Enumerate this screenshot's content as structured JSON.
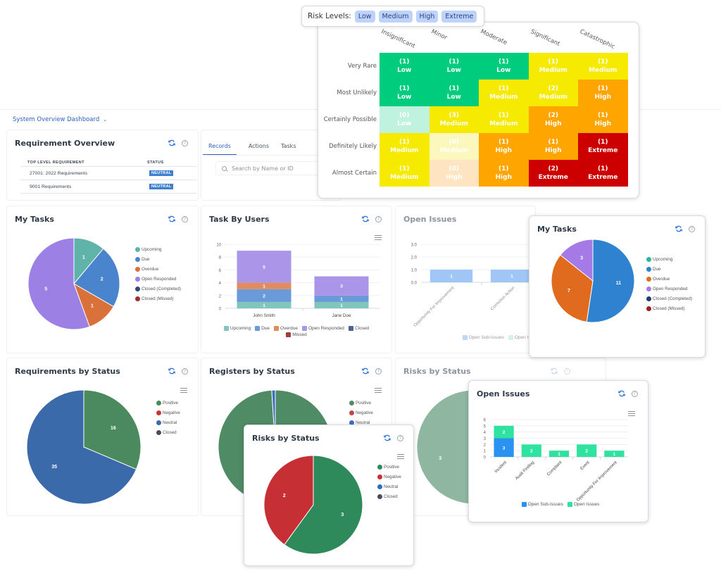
{
  "header": {
    "dashboard_title": "System Overview Dashboard",
    "dashboard_chevron_icon": "chevron-down-icon"
  },
  "risk_levels": {
    "label": "Risk Levels:",
    "chips": [
      "Low",
      "Medium",
      "High",
      "Extreme"
    ]
  },
  "risk_matrix": {
    "columns": [
      "Insignificant",
      "Minor",
      "Moderate",
      "Significant",
      "Catastrophic"
    ],
    "rows": [
      "Very Rare",
      "Most Unlikely",
      "Certainly Possible",
      "Definitely Likely",
      "Almost Certain"
    ],
    "colors": {
      "Low": "#00cc7e",
      "Low-empty": "#c0f2e0",
      "Medium": "#f5ea00",
      "Medium-empty": "#fcf8bd",
      "High": "#ffa500",
      "High-empty": "#ffe4c2",
      "Extreme": "#cc0000"
    },
    "cells": [
      [
        {
          "count": "(1)",
          "level": "Low"
        },
        {
          "count": "(1)",
          "level": "Low"
        },
        {
          "count": "(1)",
          "level": "Low"
        },
        {
          "count": "(1)",
          "level": "Medium"
        },
        {
          "count": "(1)",
          "level": "Medium"
        }
      ],
      [
        {
          "count": "(1)",
          "level": "Low"
        },
        {
          "count": "(1)",
          "level": "Low"
        },
        {
          "count": "(1)",
          "level": "Medium"
        },
        {
          "count": "(2)",
          "level": "Medium"
        },
        {
          "count": "(1)",
          "level": "High"
        }
      ],
      [
        {
          "count": "(0)",
          "level": "Low"
        },
        {
          "count": "(3)",
          "level": "Medium"
        },
        {
          "count": "(1)",
          "level": "Medium"
        },
        {
          "count": "(2)",
          "level": "High"
        },
        {
          "count": "(1)",
          "level": "High"
        }
      ],
      [
        {
          "count": "(1)",
          "level": "Medium"
        },
        {
          "count": "(0)",
          "level": "Medium"
        },
        {
          "count": "(1)",
          "level": "High"
        },
        {
          "count": "(1)",
          "level": "High"
        },
        {
          "count": "(1)",
          "level": "Extreme"
        }
      ],
      [
        {
          "count": "(1)",
          "level": "Medium"
        },
        {
          "count": "(0)",
          "level": "High"
        },
        {
          "count": "(1)",
          "level": "High"
        },
        {
          "count": "(2)",
          "level": "Extreme"
        },
        {
          "count": "(1)",
          "level": "Extreme"
        }
      ]
    ]
  },
  "requirement_overview": {
    "title": "Requirement Overview",
    "columns": [
      "TOP LEVEL REQUIREMENT",
      "STATUS"
    ],
    "rows": [
      {
        "name": "27001: 2022 Requirements",
        "status": "NEUTRAL"
      },
      {
        "name": "9001 Requirements",
        "status": "NEUTRAL"
      }
    ],
    "status_color": "#3f7fcf"
  },
  "records_panel": {
    "tabs": [
      "Records",
      "Actions",
      "Tasks"
    ],
    "active_tab": "Records",
    "search_placeholder": "Search by Name or ID"
  },
  "icons": {
    "refresh": "refresh-icon",
    "help": "help-icon",
    "help_glyph": "?",
    "menu": "hamburger-menu-icon",
    "search": "search-icon"
  },
  "chart_data": [
    {
      "id": "my_tasks_1",
      "type": "pie",
      "title": "My Tasks",
      "labels": [
        "Upcoming",
        "Due",
        "Overdue",
        "Open Responded",
        "Closed (Completed)",
        "Closed (Missed)"
      ],
      "values": [
        1,
        2,
        1,
        5,
        0,
        0
      ],
      "colors": [
        "#5fb3a8",
        "#4a84cc",
        "#d9713a",
        "#9c80e4",
        "#2f4a7a",
        "#9b2e2e"
      ],
      "legend": "right"
    },
    {
      "id": "task_by_users",
      "type": "bar",
      "stacked": true,
      "title": "Task By Users",
      "categories": [
        "John Smith",
        "Jane Doe"
      ],
      "series": [
        {
          "name": "Upcoming",
          "values": [
            1,
            1
          ],
          "color": "#80c6bd"
        },
        {
          "name": "Due",
          "values": [
            2,
            1
          ],
          "color": "#6a9ad8"
        },
        {
          "name": "Overdue",
          "values": [
            1,
            0
          ],
          "color": "#e08c5e"
        },
        {
          "name": "Open Responded",
          "values": [
            5,
            3
          ],
          "color": "#ab95e8"
        },
        {
          "name": "Closed",
          "values": [
            0,
            0
          ],
          "color": "#4b6390"
        },
        {
          "name": "Missed",
          "values": [
            0,
            0
          ],
          "color": "#a13c3c"
        }
      ],
      "yticks": [
        0,
        2,
        4,
        6,
        8,
        10
      ],
      "ylim": [
        0,
        10
      ],
      "legend": "bottom"
    },
    {
      "id": "open_issues_bg",
      "type": "bar",
      "stacked": true,
      "title": "Open Issues",
      "categories": [
        "Opportunity For Improvement",
        "Corrective Action"
      ],
      "series": [
        {
          "name": "Open Sub-Issues",
          "values": [
            1,
            1
          ],
          "color": "#8fbcf5"
        },
        {
          "name": "Open Issues",
          "values": [
            0,
            0
          ],
          "color": "#b6ecd3"
        }
      ],
      "yticks": [
        "0.0",
        "1.0",
        "2.0",
        "3.0"
      ],
      "ylim": [
        0,
        3
      ],
      "legend": "bottom"
    },
    {
      "id": "my_tasks_2",
      "type": "pie",
      "title": "My Tasks",
      "labels": [
        "Upcoming",
        "Due",
        "Overdue",
        "Open Responded",
        "Closed (Completed)",
        "Closed (Missed)"
      ],
      "values": [
        0,
        11,
        7,
        3,
        0,
        0
      ],
      "colors": [
        "#2db5a0",
        "#2f82cf",
        "#e06b1e",
        "#a57ae6",
        "#1f3c6e",
        "#9c1f1f"
      ],
      "legend": "right"
    },
    {
      "id": "requirements_by_status",
      "type": "pie",
      "title": "Requirements by Status",
      "labels": [
        "Positive",
        "Negative",
        "Neutral",
        "Closed"
      ],
      "values": [
        16,
        0,
        35,
        0
      ],
      "colors": [
        "#4a8a5e",
        "#c73434",
        "#3b6aaa",
        "#454d5e"
      ],
      "legend": "right"
    },
    {
      "id": "registers_by_status",
      "type": "pie",
      "title": "Registers by Status",
      "labels": [
        "Positive",
        "Negative",
        "Neutral",
        "Closed"
      ],
      "values": [
        99,
        0,
        1,
        0
      ],
      "colors": [
        "#4f8b64",
        "#c04545",
        "#3a6fc0",
        "#454d5e"
      ],
      "legend": "right"
    },
    {
      "id": "risks_by_status_bg",
      "type": "pie",
      "title": "Risks by Status",
      "labels": [
        "Neutral",
        "Positive"
      ],
      "values": [
        2,
        3
      ],
      "colors": [
        "#7e9ec8",
        "#8ab39b"
      ],
      "legend": "none"
    },
    {
      "id": "risks_by_status",
      "type": "pie",
      "title": "Risks by Status",
      "labels": [
        "Positive",
        "Negative",
        "Neutral",
        "Closed"
      ],
      "values": [
        3,
        2,
        0,
        0
      ],
      "colors": [
        "#2e8a5a",
        "#c62f33",
        "#2c6cc0",
        "#454d5e"
      ],
      "legend": "right"
    },
    {
      "id": "open_issues_front",
      "type": "bar",
      "stacked": true,
      "title": "Open Issues",
      "categories": [
        "Incident",
        "Audit Finding",
        "Complaint",
        "Event",
        "Opportunity For Improvement"
      ],
      "series": [
        {
          "name": "Open Sub-Issues",
          "values": [
            3,
            0,
            0,
            0,
            0
          ],
          "color": "#2a92f0"
        },
        {
          "name": "Open Issues",
          "values": [
            2,
            2,
            1,
            2,
            1
          ],
          "color": "#2ee3a0"
        }
      ],
      "yticks": [
        0,
        1,
        2,
        3,
        4,
        5,
        6
      ],
      "ylim": [
        0,
        6
      ],
      "legend": "bottom"
    }
  ]
}
